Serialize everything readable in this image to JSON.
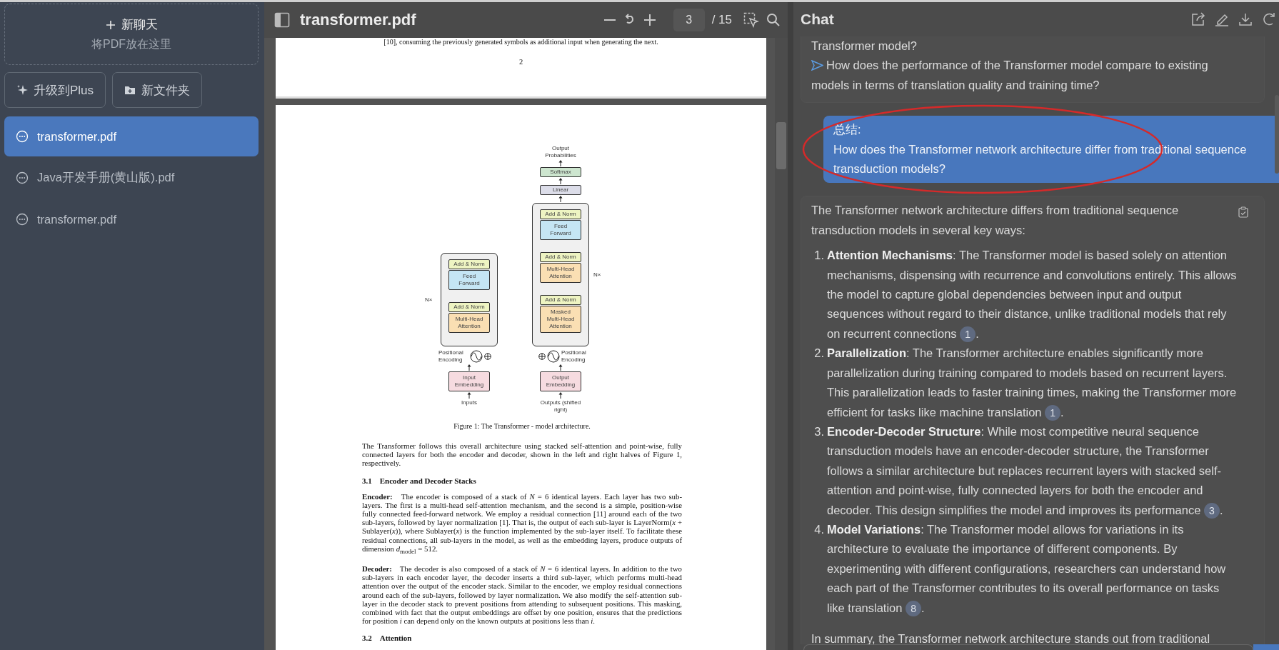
{
  "sidebar": {
    "new_chat": {
      "label": "新聊天",
      "hint": "将PDF放在这里"
    },
    "buttons": [
      {
        "kind": "upgrade",
        "label": "升级到Plus"
      },
      {
        "kind": "folder",
        "label": "新文件夹"
      }
    ],
    "items": [
      {
        "label": "transformer.pdf",
        "selected": true
      },
      {
        "label": "Java开发手册(黄山版).pdf",
        "selected": false
      },
      {
        "label": "transformer.pdf",
        "selected": false
      }
    ]
  },
  "pdf": {
    "title": "transformer.pdf",
    "page": "3",
    "total": "/ 15",
    "prev_page": {
      "line": "[10], consuming the previously generated symbols as additional input when generating the next.",
      "number": "2"
    },
    "figure": {
      "output": "Output Probabilities",
      "head": [
        {
          "label": "Softmax",
          "kind": "softmax"
        },
        {
          "label": "Linear",
          "kind": "linear"
        }
      ],
      "encoder": {
        "repeat": "N×",
        "layers": [
          {
            "label": "Add & Norm",
            "kind": "norm"
          },
          {
            "label": "Feed Forward",
            "kind": "ffn"
          },
          {
            "label": "Add & Norm",
            "kind": "norm"
          },
          {
            "label": "Multi-Head Attention",
            "kind": "attention"
          }
        ],
        "encoding": "Positional Encoding",
        "embedding": "Input Embedding",
        "input": "Inputs"
      },
      "decoder": {
        "repeat": "N×",
        "layers": [
          {
            "label": "Add & Norm",
            "kind": "norm"
          },
          {
            "label": "Feed Forward",
            "kind": "ffn"
          },
          {
            "label": "Add & Norm",
            "kind": "norm"
          },
          {
            "label": "Multi-Head Attention",
            "kind": "attention"
          },
          {
            "label": "Add & Norm",
            "kind": "norm"
          },
          {
            "label": "Masked Multi-Head Attention",
            "kind": "attention"
          }
        ],
        "encoding": "Positional Encoding",
        "embedding": "Output Embedding",
        "input": "Outputs (shifted right)"
      },
      "caption": "Figure 1: The Transformer - model architecture."
    },
    "blocks": [
      {
        "kind": "para",
        "text": "The Transformer follows this overall architecture using stacked self-attention and point-wise, fully connected layers for both the encoder and decoder, shown in the left and right halves of Figure 1, respectively."
      },
      {
        "kind": "heading",
        "number": "3.1",
        "text": "Encoder and Decoder Stacks"
      },
      {
        "kind": "para",
        "lead": "Encoder:",
        "text": "The encoder is composed of a stack of *N* = 6 identical layers. Each layer has two sub-layers. The first is a multi-head self-attention mechanism, and the second is a simple, position-wise fully connected feed-forward network. We employ a residual connection [11] around each of the two sub-layers, followed by layer normalization [1]. That is, the output of each sub-layer is LayerNorm(*x* + Sublayer(*x*)), where Sublayer(*x*) is the function implemented by the sub-layer itself. To facilitate these residual connections, all sub-layers in the model, as well as the embedding layers, produce outputs of dimension *d*$_{model}$ = 512."
      },
      {
        "kind": "para",
        "lead": "Decoder:",
        "text": "The decoder is also composed of a stack of *N* = 6 identical layers. In addition to the two sub-layers in each encoder layer, the decoder inserts a third sub-layer, which performs multi-head attention over the output of the encoder stack. Similar to the encoder, we employ residual connections around each of the sub-layers, followed by layer normalization. We also modify the self-attention sub-layer in the decoder stack to prevent positions from attending to subsequent positions. This masking, combined with fact that the output embeddings are offset by one position, ensures that the predictions for position *i* can depend only on the known outputs at positions less than *i*."
      },
      {
        "kind": "heading",
        "number": "3.2",
        "text": "Attention"
      }
    ]
  },
  "chat": {
    "title": "Chat",
    "messages": [
      {
        "kind": "suggestions",
        "items": [
          {
            "text": "Transformer model?",
            "arrow": false
          },
          {
            "text": "How does the performance of the Transformer model compare to existing models in terms of translation quality and training time?",
            "arrow": true
          }
        ]
      },
      {
        "kind": "user",
        "label": "总结:",
        "text": "How does the Transformer network architecture differ from traditional sequence transduction models?"
      },
      {
        "kind": "answer",
        "intro": "The Transformer network architecture differs from traditional sequence transduction models in several key ways:",
        "points": [
          {
            "number": "1.",
            "title": "Attention Mechanisms",
            "text": ": The Transformer model is based solely on attention mechanisms, dispensing with recurrence and convolutions entirely. This allows the model to capture global dependencies between input and output sequences without regard to their distance, unlike traditional models that rely on recurrent connections",
            "cite": "1",
            "end": "."
          },
          {
            "number": "2.",
            "title": "Parallelization",
            "text": ": The Transformer architecture enables significantly more parallelization during training compared to models based on recurrent layers. This parallelization leads to faster training times, making the Transformer more efficient for tasks like machine translation",
            "cite": "1",
            "end": "."
          },
          {
            "number": "3.",
            "title": "Encoder-Decoder Structure",
            "text": ": While most competitive neural sequence transduction models have an encoder-decoder structure, the Transformer follows a similar architecture but replaces recurrent layers with stacked self-attention and point-wise, fully connected layers for both the encoder and decoder. This design simplifies the model and improves its performance",
            "cite": "3",
            "end": "."
          },
          {
            "number": "4.",
            "title": "Model Variations",
            "text": ": The Transformer model allows for variations in its architecture to evaluate the importance of different components. By experimenting with different configurations, researchers can understand how each part of the Transformer contributes to its overall performance on tasks like translation",
            "cite": "8",
            "end": "."
          }
        ],
        "outro": "In summary, the Transformer network architecture stands out from traditional"
      }
    ]
  }
}
